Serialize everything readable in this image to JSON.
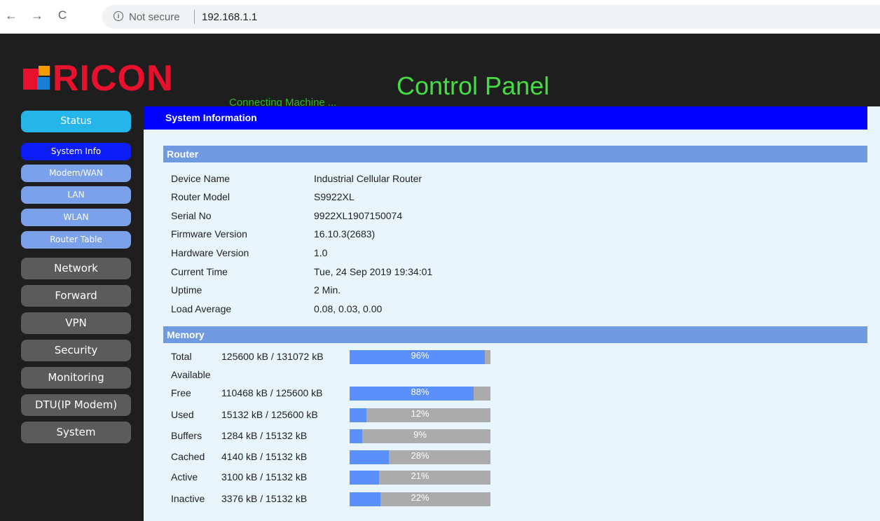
{
  "browser": {
    "back_icon": "←",
    "forward_icon": "→",
    "reload_icon": "C",
    "info_icon": "i",
    "security_text": "Not secure",
    "url": "192.168.1.1"
  },
  "header": {
    "logo_text": "RICON",
    "tagline": "Connecting Machine ...",
    "title": "Control Panel"
  },
  "sidebar": {
    "status": "Status",
    "sub_items": [
      {
        "label": "System Info",
        "active": true
      },
      {
        "label": "Modem/WAN",
        "active": false
      },
      {
        "label": "LAN",
        "active": false
      },
      {
        "label": "WLAN",
        "active": false
      },
      {
        "label": "Router Table",
        "active": false
      }
    ],
    "main_items": [
      "Network",
      "Forward",
      "VPN",
      "Security",
      "Monitoring",
      "DTU(IP Modem)",
      "System"
    ]
  },
  "content": {
    "heading": "System Information",
    "router_section": "Router",
    "router": [
      {
        "label": "Device Name",
        "value": "Industrial Cellular Router"
      },
      {
        "label": "Router Model",
        "value": "S9922XL"
      },
      {
        "label": "Serial No",
        "value": "9922XL1907150074"
      },
      {
        "label": "Firmware Version",
        "value": "16.10.3(2683)"
      },
      {
        "label": "Hardware Version",
        "value": "1.0"
      },
      {
        "label": "Current Time",
        "value": "Tue, 24 Sep 2019 19:34:01"
      },
      {
        "label": "Uptime",
        "value": "2 Min."
      },
      {
        "label": "Load Average",
        "value": "0.08, 0.03, 0.00"
      }
    ],
    "memory_section": "Memory",
    "memory": [
      {
        "label": "Total",
        "label2": "Available",
        "value": "125600 kB / 131072 kB",
        "percent_text": "96%",
        "fraction": 0.96
      },
      {
        "label": "Free",
        "value": "110468 kB / 125600 kB",
        "percent_text": "88%",
        "fraction": 0.88
      },
      {
        "label": "Used",
        "value": "15132 kB / 125600 kB",
        "percent_text": "12%",
        "fraction": 0.12
      },
      {
        "label": "Buffers",
        "value": "1284 kB / 15132 kB",
        "percent_text": "9%",
        "fraction": 0.09
      },
      {
        "label": "Cached",
        "value": "4140 kB / 15132 kB",
        "percent_text": "28%",
        "fraction": 0.28
      },
      {
        "label": "Active",
        "value": "3100 kB / 15132 kB",
        "percent_text": "21%",
        "fraction": 0.21
      },
      {
        "label": "Inactive",
        "value": "3376 kB / 15132 kB",
        "percent_text": "22%",
        "fraction": 0.22
      }
    ]
  }
}
